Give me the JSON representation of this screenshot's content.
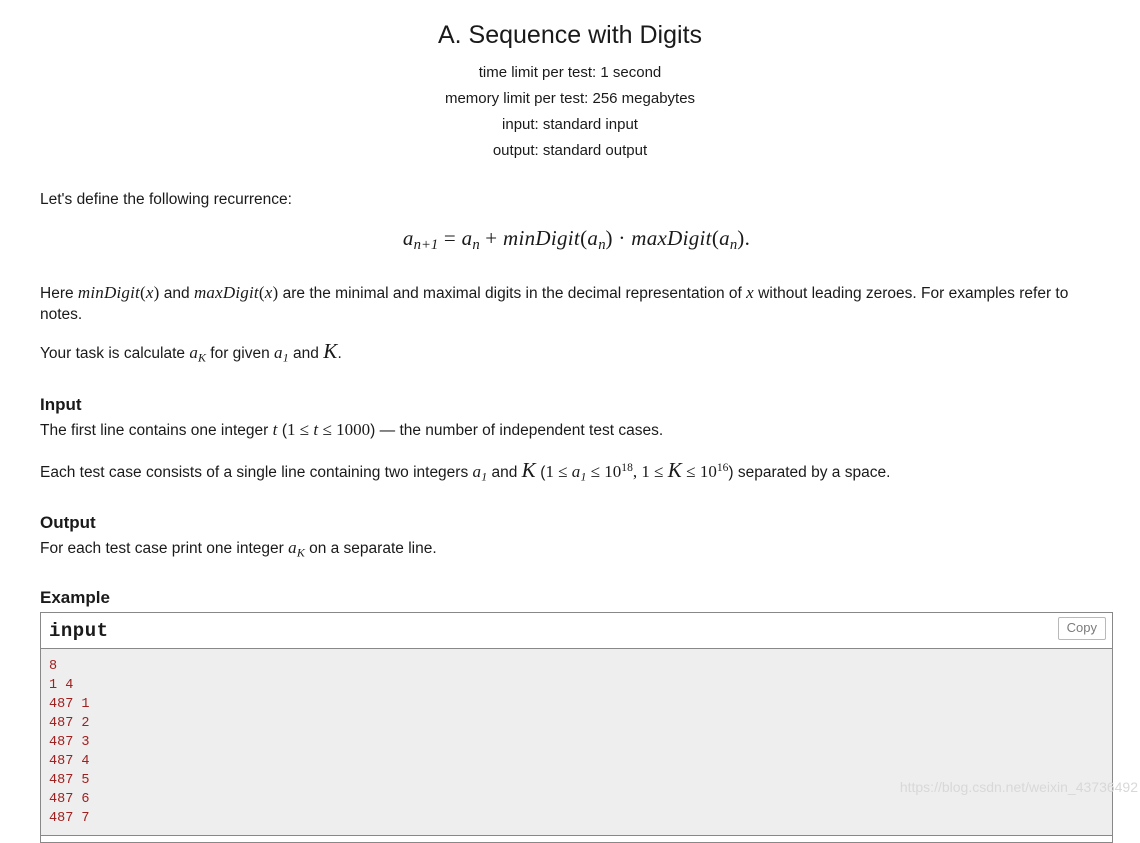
{
  "problem": {
    "title": "A. Sequence with Digits",
    "limits": [
      "time limit per test: 1 second",
      "memory limit per test: 256 megabytes",
      "input: standard input",
      "output: standard output"
    ]
  },
  "statement": {
    "intro": "Let's define the following recurrence:",
    "formula": "a_{n+1} = a_n + minDigit(a_n) · maxDigit(a_n).",
    "formula_parts": {
      "lhs_base": "a",
      "lhs_sub": "n+1",
      "equals": "=",
      "rhs_base": "a",
      "rhs_sub": "n",
      "plus": "+",
      "min_fn": "minDigit",
      "dot": "·",
      "max_fn": "maxDigit",
      "arg_base": "a",
      "arg_sub": "n",
      "period": "."
    },
    "here_paragraph": {
      "p1": "Here ",
      "min_fn": "minDigit",
      "arg_x": "x",
      "p2": " and ",
      "max_fn": "maxDigit",
      "p3": " are the minimal and maximal digits in the decimal representation of ",
      "var_x": "x",
      "p4": " without leading zeroes. For examples refer to notes."
    },
    "task_paragraph": {
      "p1": "Your task is calculate ",
      "a_base": "a",
      "a_sub": "K",
      "p2": " for given ",
      "a1_base": "a",
      "a1_sub": "1",
      "p3": " and ",
      "K": "K",
      "p4": "."
    }
  },
  "input_section": {
    "heading": "Input",
    "line1": {
      "p1": "The first line contains one integer ",
      "t": "t",
      "p2": " (",
      "lo": "1",
      "le1": "≤",
      "t2": "t",
      "le2": "≤",
      "hi": "1000",
      "p3": ") — the number of independent test cases."
    },
    "line2": {
      "p1": "Each test case consists of a single line containing two integers ",
      "a_base": "a",
      "a_sub": "1",
      "p2": " and ",
      "K": "K",
      "p3": " (",
      "one_a": "1",
      "le1": "≤",
      "a2_base": "a",
      "a2_sub": "1",
      "le2": "≤",
      "ten1": "10",
      "exp1": "18",
      "comma": ", ",
      "one_k": "1",
      "le3": "≤",
      "K2": "K",
      "le4": "≤",
      "ten2": "10",
      "exp2": "16",
      "p4": ") separated by a space."
    }
  },
  "output_section": {
    "heading": "Output",
    "line1": {
      "p1": "For each test case print one integer ",
      "a_base": "a",
      "a_sub": "K",
      "p2": " on a separate line."
    }
  },
  "example_section": {
    "heading": "Example",
    "input_box": {
      "title": "input",
      "copy_label": "Copy",
      "content": "8\n1 4\n487 1\n487 2\n487 3\n487 4\n487 5\n487 6\n487 7"
    }
  },
  "watermark": {
    "text": "https://blog.csdn.net/weixin_43736492"
  },
  "colors": {
    "text": "#1a1a1a",
    "code": "#9f2020",
    "code_bg": "#eeeeee",
    "border": "#888888",
    "copy_text": "#7b7b7b",
    "watermark": "#d8d8d8"
  }
}
